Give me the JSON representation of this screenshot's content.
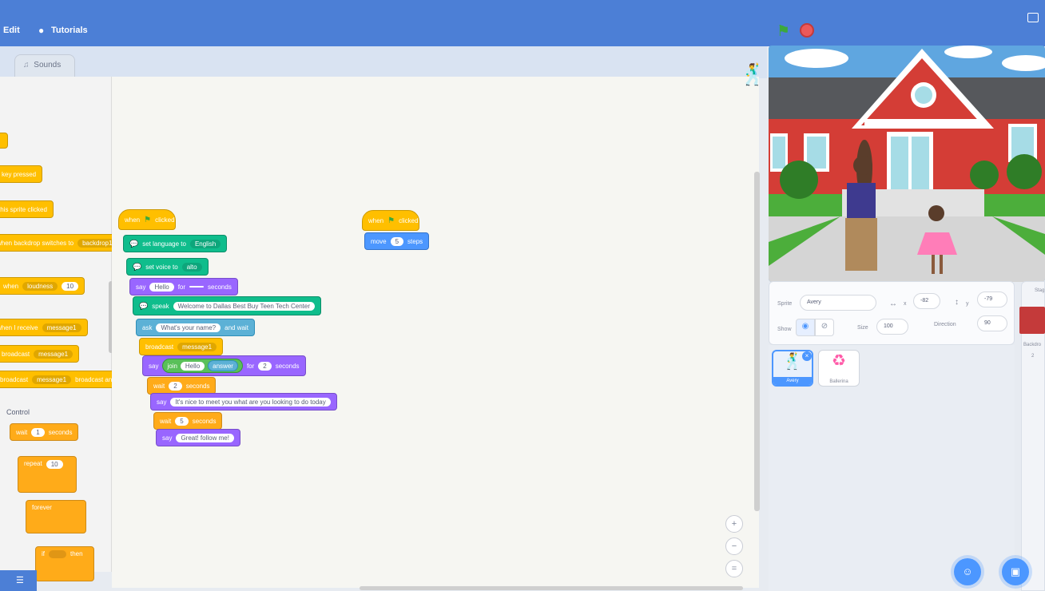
{
  "menu": {
    "edit": "Edit",
    "tutorials": "Tutorials"
  },
  "tabs": {
    "sounds": "Sounds"
  },
  "palette": {
    "event_blocks": [
      "key pressed",
      "this sprite clicked",
      "when backdrop switches to",
      "backdrop1",
      "when",
      "loudness",
      "10",
      "when I receive",
      "message1",
      "broadcast",
      "broadcast and wait"
    ],
    "section_label": "Control",
    "control_blocks": [
      {
        "label": "wait",
        "value": "1",
        "suffix": "seconds"
      },
      {
        "label": "repeat",
        "value": "10"
      },
      {
        "label": "forever"
      },
      {
        "label": "if",
        "suffix": "then"
      }
    ]
  },
  "script1": {
    "hat": {
      "when": "when",
      "clicked": "clicked"
    },
    "set_language": {
      "label": "set language to",
      "value": "English"
    },
    "set_voice": {
      "label": "set voice to",
      "value": "alto"
    },
    "say_for": {
      "say": "say",
      "value": "Hello",
      "for": "for",
      "secs": "",
      "seconds": "seconds"
    },
    "speak": {
      "label": "speak",
      "value": "Welcome to Dallas Best Buy Teen Tech Center"
    },
    "ask": {
      "label": "ask",
      "value": "What's your name?",
      "suffix": "and wait"
    },
    "broadcast": {
      "label": "broadcast",
      "value": "message1"
    },
    "say_join": {
      "say": "say",
      "join": "join",
      "v1": "Hello",
      "v2": "answer",
      "for": "for",
      "secs": "2",
      "seconds": "seconds"
    },
    "wait1": {
      "label": "wait",
      "value": "2",
      "seconds": "seconds"
    },
    "say2": {
      "say": "say",
      "value": "It's nice to meet you what are you looking to do today"
    },
    "wait2": {
      "label": "wait",
      "value": "5",
      "seconds": "seconds"
    },
    "say3": {
      "say": "say",
      "value": "Great! follow me!"
    }
  },
  "script2": {
    "hat": {
      "when": "when",
      "clicked": "clicked"
    },
    "move": {
      "label": "move",
      "value": "5",
      "suffix": "steps"
    }
  },
  "sprite_info": {
    "sprite_label": "Sprite",
    "sprite_name": "Avery",
    "x_label": "x",
    "x_value": "-82",
    "y_label": "y",
    "y_value": "-79",
    "show_label": "Show",
    "size_label": "Size",
    "size_value": "100",
    "direction_label": "Direction",
    "direction_value": "90"
  },
  "sprites": [
    {
      "name": "Avery",
      "selected": true
    },
    {
      "name": "Ballerina",
      "selected": false
    }
  ],
  "stage_panel": {
    "title": "Stag",
    "backdrops_label": "Backdro",
    "backdrops_count": "2"
  },
  "colors": {
    "menubar": "#4c7fd6",
    "events": "#ffbf00",
    "control": "#ffab19",
    "looks": "#9966ff",
    "text_to_speech": "#0fbd8c",
    "sensing": "#5cb1d6",
    "motion": "#4c97ff",
    "operators": "#59c059"
  },
  "icons": [
    "tutorials-bulb-icon",
    "green-flag-icon",
    "stop-icon",
    "fullscreen-icon",
    "sounds-icon",
    "zoom-in-icon",
    "zoom-out-icon",
    "zoom-reset-icon",
    "choose-sprite-icon",
    "choose-backdrop-icon",
    "extension-icon",
    "eye-icon",
    "eye-off-icon",
    "delete-sprite-icon"
  ]
}
